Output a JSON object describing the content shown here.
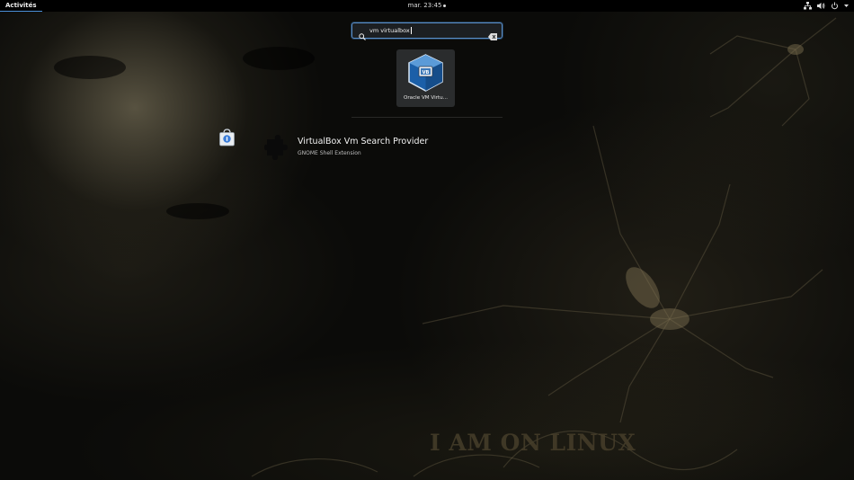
{
  "topbar": {
    "activities_label": "Activités",
    "clock": "mar. 23:45",
    "tray_icons": [
      "network-icon",
      "volume-icon",
      "power-icon"
    ]
  },
  "search": {
    "value": "vm virtualbox",
    "icon": "search-icon",
    "clear_icon": "clear-icon",
    "accent": "#4a90d9"
  },
  "app_results": [
    {
      "label": "Oracle VM Virtu...",
      "icon": "virtualbox-icon"
    }
  ],
  "provider_results": [
    {
      "provider_icon": "software-store-icon",
      "icon": "puzzle-extension-icon",
      "title": "VirtualBox Vm Search Provider",
      "subtitle": "GNOME Shell Extension"
    }
  ],
  "wallpaper": {
    "text": "I AM ON LINUX"
  }
}
